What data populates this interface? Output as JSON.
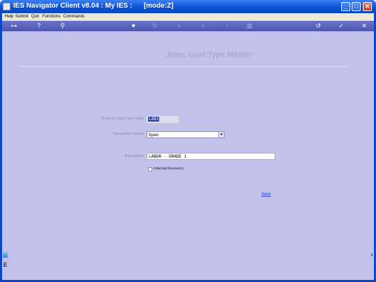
{
  "window": {
    "title": "IES Navigator Client v8.04 : My IES :      [mode:Z]"
  },
  "window_controls": {
    "minimize": "_",
    "maximize": "□",
    "close": "✕"
  },
  "menu": {
    "items": [
      "Help",
      "Submit",
      "Quit",
      "Functions",
      "Commands"
    ]
  },
  "toolbar": {
    "icons": [
      "key-icon",
      "help-icon",
      "search-icon",
      "heart-icon",
      "refresh-icon",
      "back-icon",
      "forward-icon",
      "up-icon",
      "calendar-icon",
      "undo-icon",
      "check-icon",
      "close-icon"
    ]
  },
  "page": {
    "title": "Jobs: Cost Type Master"
  },
  "form": {
    "code_label": "Event or Cost Type Code",
    "code_value": "LAB1",
    "status_label": "Transaction Status",
    "status_value": "Open",
    "description_label": "Description",
    "description_value": "LABOR - GRADE 1",
    "internal_recovery_label": "Internal Recovery",
    "internal_recovery_checked": false,
    "save_label": "Save"
  },
  "sidebar": {
    "bottom_char": "E"
  },
  "colors": {
    "titlebar": "#0b52d6",
    "toolbar": "#5a60bd",
    "content_bg": "#c2c1ea",
    "page_title": "#a9a8d6",
    "link": "#2a3ad8"
  }
}
